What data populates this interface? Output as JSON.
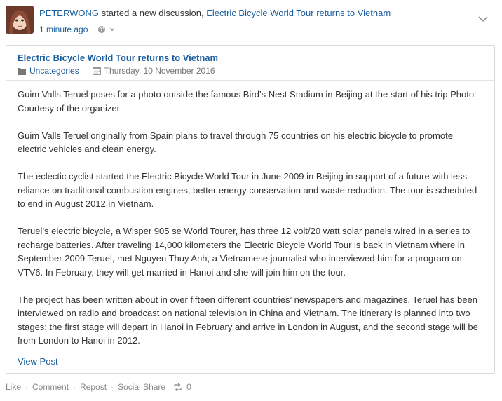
{
  "header": {
    "username": "PETERWONG",
    "action_text": " started a new discussion, ",
    "discussion_link": "Electric Bicycle World Tour returns to Vietnam",
    "timestamp": "1 minute ago",
    "privacy_icon": "globe-icon"
  },
  "post": {
    "title": "Electric Bicycle World Tour returns to Vietnam",
    "category": "Uncategories",
    "date": "Thursday, 10 November 2016",
    "paragraphs": [
      "Guim Valls Teruel poses for a photo outside the famous Bird’s Nest Stadium in Beijing at the start of his trip Photo: Courtesy of the organizer",
      "Guim Valls Teruel originally from Spain plans to travel through 75 countries on his electric bicycle to promote electric vehicles and clean energy.",
      "The eclectic cyclist started the Electric Bicycle World Tour in June 2009 in Beijing in support of a future with less reliance on traditional combustion engines, better energy conservation and waste reduction. The tour is scheduled to end in August 2012 in Vietnam.",
      "Teruel’s electric bicycle, a Wisper 905 se World Tourer, has three 12 volt/20 watt solar panels wired in a series to recharge batteries. After traveling 14,000 kilometers the Electric Bicycle World Tour is back in Vietnam where in September 2009 Teruel, met Nguyen Thuy Anh, a Vietnamese journalist who interviewed him for a program on VTV6. In February, they will get married in Hanoi and she will join him on the tour.",
      "The project has been written about in over fifteen different countries’ newspapers and magazines. Teruel has been interviewed on radio and broadcast on national television in China and Vietnam. The itinerary is planned into two stages: the first stage will depart in Hanoi in February and arrive in London in August, and the second stage will be from London to Hanoi in 2012."
    ],
    "view_post_label": "View Post"
  },
  "actions": {
    "like": "Like",
    "comment": "Comment",
    "repost": "Repost",
    "social_share": "Social Share",
    "share_count": "0"
  },
  "colors": {
    "link": "#1a5d9c",
    "text": "#333333",
    "muted": "#888888",
    "border": "#d9d9d9"
  }
}
